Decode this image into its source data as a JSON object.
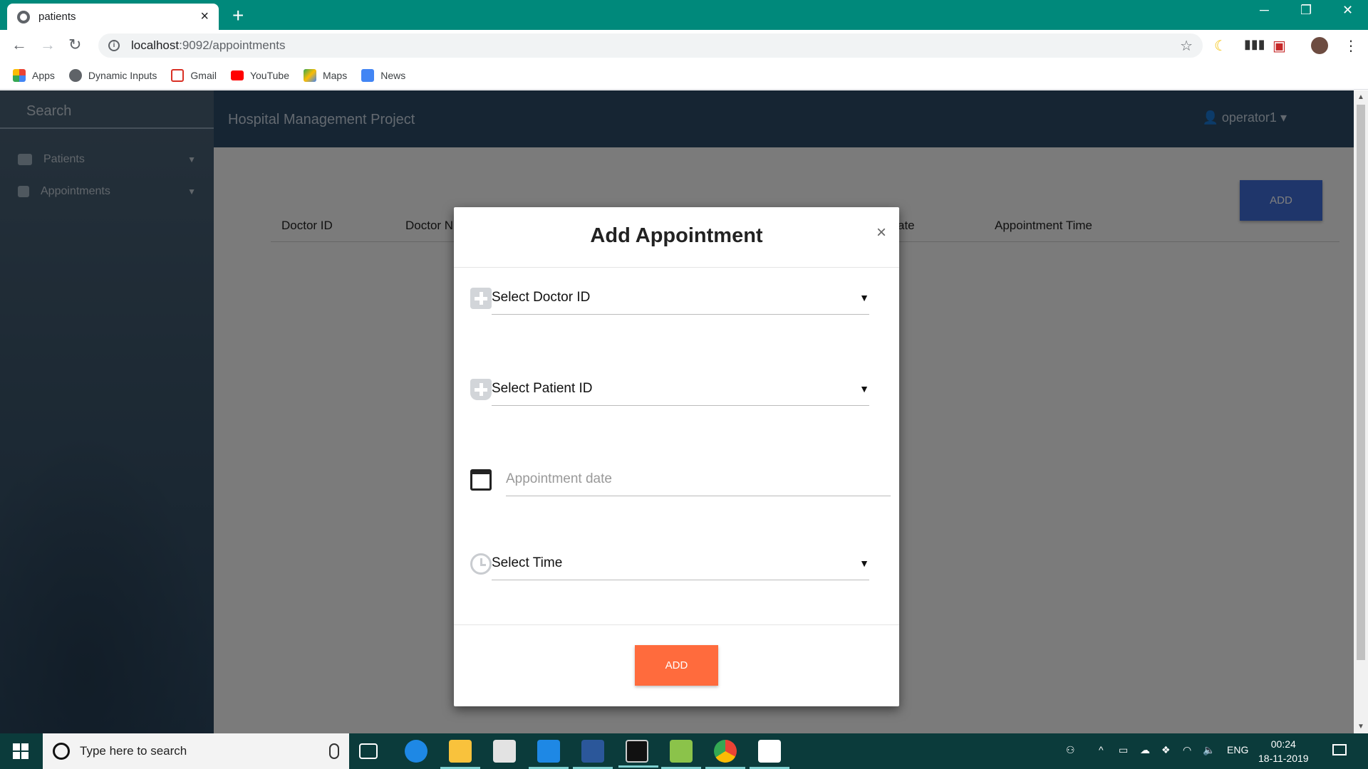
{
  "browser": {
    "tab_title": "patients",
    "tab_close": "×",
    "new_tab": "+",
    "url_host": "localhost",
    "url_path": ":9092/appointments",
    "window_controls": {
      "minimize": "─",
      "restore": "❐",
      "close": "✕"
    }
  },
  "bookmarks": [
    {
      "label": "Apps",
      "icon": "apps-grid-icon",
      "color": "#ea4335"
    },
    {
      "label": "Dynamic Inputs",
      "icon": "globe-icon",
      "color": "#5f6368"
    },
    {
      "label": "Gmail",
      "icon": "gmail-icon",
      "color": "#d93025"
    },
    {
      "label": "YouTube",
      "icon": "youtube-icon",
      "color": "#ff0000"
    },
    {
      "label": "Maps",
      "icon": "maps-icon",
      "color": "#34a853"
    },
    {
      "label": "News",
      "icon": "news-icon",
      "color": "#4285f4"
    }
  ],
  "app": {
    "search_label": "Search",
    "brand": "Hospital Management Project",
    "user": "operator1",
    "sidebar": [
      {
        "label": "Patients",
        "icon": "ambulance-icon"
      },
      {
        "label": "Appointments",
        "icon": "calendar-icon"
      }
    ],
    "add_button": "ADD",
    "table_headers": [
      "Doctor ID",
      "Doctor N",
      "ate",
      "Appointment Time"
    ]
  },
  "modal": {
    "title": "Add Appointment",
    "close": "×",
    "doctor_select": "Select Doctor ID",
    "patient_select": "Select Patient ID",
    "date_placeholder": "Appointment date",
    "time_select": "Select Time",
    "submit": "ADD",
    "colors": {
      "submit": "#ff6b3d",
      "header_add": "#3f6dd6"
    }
  },
  "taskbar": {
    "search_placeholder": "Type here to search",
    "language": "ENG",
    "time": "00:24",
    "date": "18-11-2019"
  }
}
